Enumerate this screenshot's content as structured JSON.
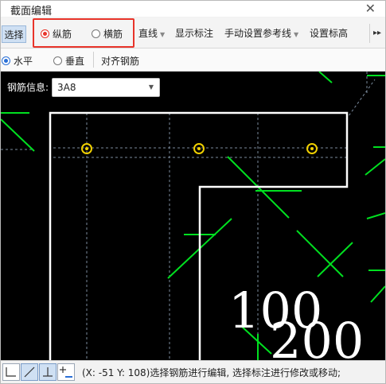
{
  "window": {
    "title": "截面编辑"
  },
  "toolbar": {
    "select_label": "选择",
    "longitudinal_label": "纵筋",
    "transverse_label": "横筋",
    "line_label": "直线",
    "show_annotation_label": "显示标注",
    "manual_ref_label": "手动设置参考线",
    "set_elevation_label": "设置标高"
  },
  "row2": {
    "horizontal_label": "水平",
    "vertical_label": "垂直",
    "align_label": "对齐钢筋"
  },
  "canvas": {
    "rebar_info_label": "钢筋信息:",
    "rebar_value": "3A8",
    "dim_100": "100",
    "dim_200": "200"
  },
  "status": {
    "text": "(X: -51 Y: 108)选择钢筋进行编辑, 选择标注进行修改或移动;"
  },
  "colors": {
    "highlight": "#e8342a",
    "rebar_green": "#00e020",
    "rebar_yellow": "#f0d000"
  },
  "icons": [
    "close-icon",
    "chevron-down-icon",
    "more-icon",
    "rebar-marker-icon",
    "snap-icons"
  ]
}
